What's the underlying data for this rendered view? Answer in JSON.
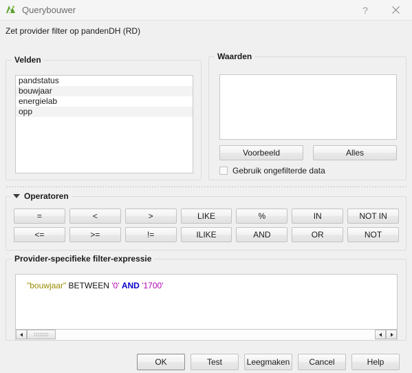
{
  "window": {
    "title": "Querybouwer",
    "icon": "qgis-logo-icon",
    "help_label": "?",
    "close_label": "✕"
  },
  "subtitle": "Zet provider filter op pandenDH (RD)",
  "fields_group": {
    "title": "Velden",
    "items": [
      {
        "label": "pandstatus"
      },
      {
        "label": "bouwjaar"
      },
      {
        "label": "energielab"
      },
      {
        "label": "opp"
      }
    ]
  },
  "values_group": {
    "title": "Waarden",
    "items": [],
    "sample_label": "Voorbeeld",
    "all_label": "Alles",
    "unfiltered_label": "Gebruik ongefilterde data",
    "unfiltered_checked": false
  },
  "operators_group": {
    "title": "Operatoren",
    "expanded": true,
    "buttons": [
      "=",
      "<",
      ">",
      "LIKE",
      "%",
      "IN",
      "NOT IN",
      "<=",
      ">=",
      "!=",
      "ILIKE",
      "AND",
      "OR",
      "NOT"
    ]
  },
  "expression_group": {
    "title": "Provider-specifieke filter-expressie",
    "expression": "\"bouwjaar\" BETWEEN '0' AND '1700'",
    "tokens": [
      {
        "text": "\"bouwjaar\"",
        "type": "field"
      },
      {
        "text": " BETWEEN ",
        "type": "plain"
      },
      {
        "text": "'0'",
        "type": "string"
      },
      {
        "text": " ",
        "type": "plain"
      },
      {
        "text": "AND",
        "type": "keyword"
      },
      {
        "text": " ",
        "type": "plain"
      },
      {
        "text": "'1700'",
        "type": "string"
      }
    ],
    "scroll": {
      "left_arrow": "◀",
      "right_arrow": "▶"
    }
  },
  "dialog_buttons": [
    {
      "label": "OK",
      "default": true
    },
    {
      "label": "Test",
      "default": false
    },
    {
      "label": "Leegmaken",
      "default": false
    },
    {
      "label": "Cancel",
      "default": false
    },
    {
      "label": "Help",
      "default": false
    }
  ],
  "colors": {
    "window_bg": "#f0f0f0",
    "titlebar_bg": "#f5f5f5",
    "field_token": "#9a8a00",
    "string_token": "#b000b0",
    "keyword_token": "#0a00c8"
  }
}
